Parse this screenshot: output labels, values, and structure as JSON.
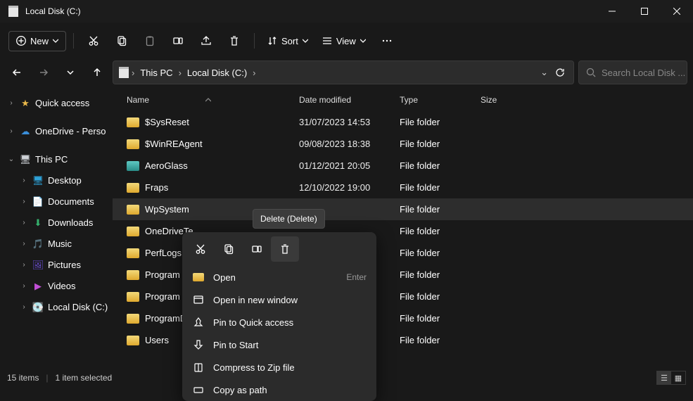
{
  "window": {
    "title": "Local Disk  (C:)"
  },
  "toolbar": {
    "new_label": "New",
    "sort_label": "Sort",
    "view_label": "View"
  },
  "breadcrumbs": [
    "This PC",
    "Local Disk  (C:)"
  ],
  "search": {
    "placeholder": "Search Local Disk  ..."
  },
  "sidebar": {
    "quick_access": "Quick access",
    "onedrive": "OneDrive - Perso",
    "this_pc": "This PC",
    "children": [
      {
        "label": "Desktop",
        "icon": "desktop",
        "color": "#2ea2d9"
      },
      {
        "label": "Documents",
        "icon": "doc",
        "color": "#cfd3d8"
      },
      {
        "label": "Downloads",
        "icon": "download",
        "color": "#35b26d"
      },
      {
        "label": "Music",
        "icon": "music",
        "color": "#e24a4a"
      },
      {
        "label": "Pictures",
        "icon": "picture",
        "color": "#6a4fd6"
      },
      {
        "label": "Videos",
        "icon": "video",
        "color": "#c24fd6"
      },
      {
        "label": "Local Disk  (C:)",
        "icon": "disk",
        "color": "#cfd3d8"
      }
    ]
  },
  "columns": {
    "name": "Name",
    "date": "Date modified",
    "type": "Type",
    "size": "Size"
  },
  "rows": [
    {
      "name": "$SysReset",
      "date": "31/07/2023 14:53",
      "type": "File folder",
      "size": "",
      "icon": "folder"
    },
    {
      "name": "$WinREAgent",
      "date": "09/08/2023 18:38",
      "type": "File folder",
      "size": "",
      "icon": "folder"
    },
    {
      "name": "AeroGlass",
      "date": "01/12/2021 20:05",
      "type": "File folder",
      "size": "",
      "icon": "teal"
    },
    {
      "name": "Fraps",
      "date": "12/10/2022 19:00",
      "type": "File folder",
      "size": "",
      "icon": "folder"
    },
    {
      "name": "WpSystem",
      "date": "",
      "type": "File folder",
      "size": "",
      "icon": "folder",
      "selected": true
    },
    {
      "name": "OneDriveTe",
      "date": "",
      "type": "File folder",
      "size": "",
      "icon": "folder"
    },
    {
      "name": "PerfLogs",
      "date": "",
      "type": "File folder",
      "size": "",
      "icon": "folder"
    },
    {
      "name": "Program File",
      "date": "",
      "type": "File folder",
      "size": "",
      "icon": "folder"
    },
    {
      "name": "Program File",
      "date": "",
      "type": "File folder",
      "size": "",
      "icon": "folder"
    },
    {
      "name": "ProgramDat",
      "date": "",
      "type": "File folder",
      "size": "",
      "icon": "folder"
    },
    {
      "name": "Users",
      "date": "",
      "type": "File folder",
      "size": "",
      "icon": "folder"
    }
  ],
  "tooltip": {
    "text": "Delete (Delete)"
  },
  "context_menu": {
    "items": [
      {
        "label": "Open",
        "shortcut": "Enter",
        "icon": "folder"
      },
      {
        "label": "Open in new window",
        "shortcut": "",
        "icon": "window"
      },
      {
        "label": "Pin to Quick access",
        "shortcut": "",
        "icon": "pin"
      },
      {
        "label": "Pin to Start",
        "shortcut": "",
        "icon": "pin-start"
      },
      {
        "label": "Compress to Zip file",
        "shortcut": "",
        "icon": "zip"
      },
      {
        "label": "Copy as path",
        "shortcut": "",
        "icon": "path"
      }
    ]
  },
  "status": {
    "items": "15 items",
    "selected": "1 item selected"
  }
}
